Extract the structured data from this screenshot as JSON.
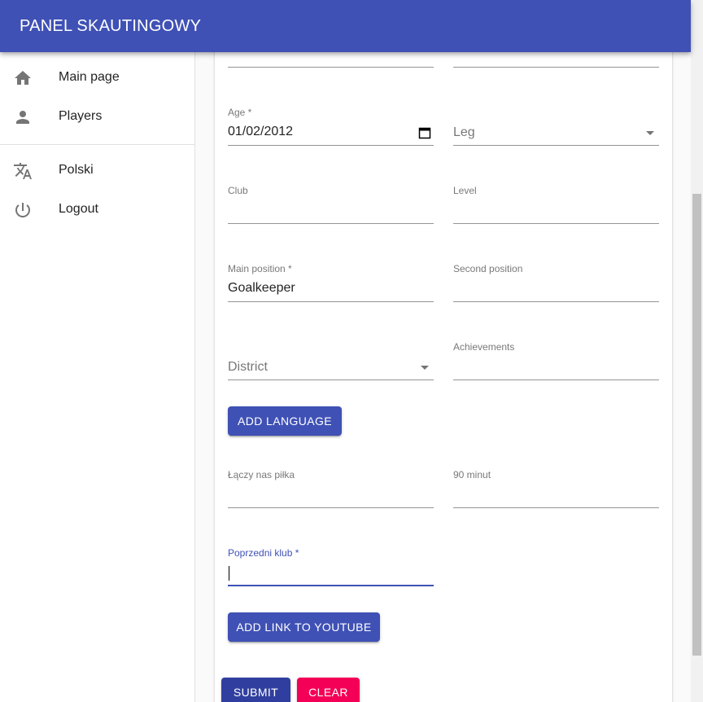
{
  "app": {
    "title": "PANEL SKAUTINGOWY"
  },
  "sidebar": {
    "items": [
      {
        "icon": "home-icon",
        "label": "Main page"
      },
      {
        "icon": "person-icon",
        "label": "Players"
      },
      {
        "icon": "translate-icon",
        "label": "Polski"
      },
      {
        "icon": "power-icon",
        "label": "Logout"
      }
    ]
  },
  "form": {
    "age": {
      "label": "Age *",
      "value": "01/02/2012"
    },
    "leg": {
      "placeholder": "Leg"
    },
    "club": {
      "label": "Club",
      "value": ""
    },
    "level": {
      "label": "Level",
      "value": ""
    },
    "main_position": {
      "label": "Main position *",
      "value": "Goalkeeper"
    },
    "second_position": {
      "label": "Second position",
      "value": ""
    },
    "district": {
      "placeholder": "District"
    },
    "achievements": {
      "label": "Achievements",
      "value": ""
    },
    "add_language_label": "ADD LANGUAGE",
    "laczy_nas_pilka": {
      "label": "Łączy nas piłka",
      "value": ""
    },
    "minut90": {
      "label": "90 minut",
      "value": ""
    },
    "poprzedni_klub": {
      "label": "Poprzedni klub *",
      "value": ""
    },
    "add_youtube_label": "ADD LINK TO YOUTUBE",
    "submit_label": "SUBMIT",
    "clear_label": "CLEAR"
  },
  "colors": {
    "primary": "#3f51b5",
    "primary_dark": "#303f9f",
    "secondary": "#f50057"
  }
}
